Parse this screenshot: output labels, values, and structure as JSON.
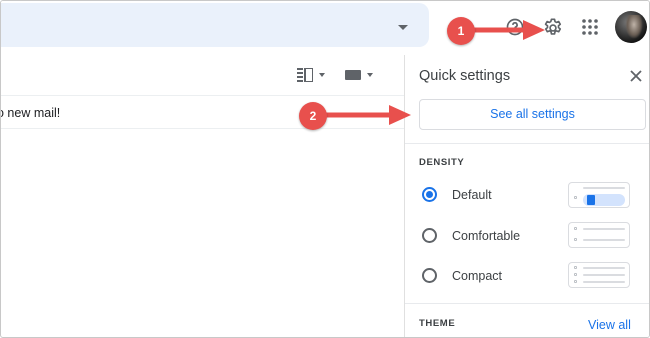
{
  "mail": {
    "empty_message": "o new mail!"
  },
  "quick_settings": {
    "title": "Quick settings",
    "see_all_label": "See all settings",
    "density_heading": "DENSITY",
    "options": [
      {
        "label": "Default",
        "selected": true
      },
      {
        "label": "Comfortable",
        "selected": false
      },
      {
        "label": "Compact",
        "selected": false
      }
    ],
    "theme_heading": "THEME",
    "view_all_label": "View all"
  },
  "annotations": {
    "step1": "1",
    "step2": "2"
  },
  "colors": {
    "accent": "#1a73e8",
    "annotation": "#e8504d",
    "search_bg": "#eaf1fb"
  },
  "icons": [
    "chevron-down-icon",
    "help-icon",
    "gear-icon",
    "apps-icon",
    "split-pane-icon",
    "keyboard-icon",
    "close-icon",
    "radio-icon"
  ]
}
